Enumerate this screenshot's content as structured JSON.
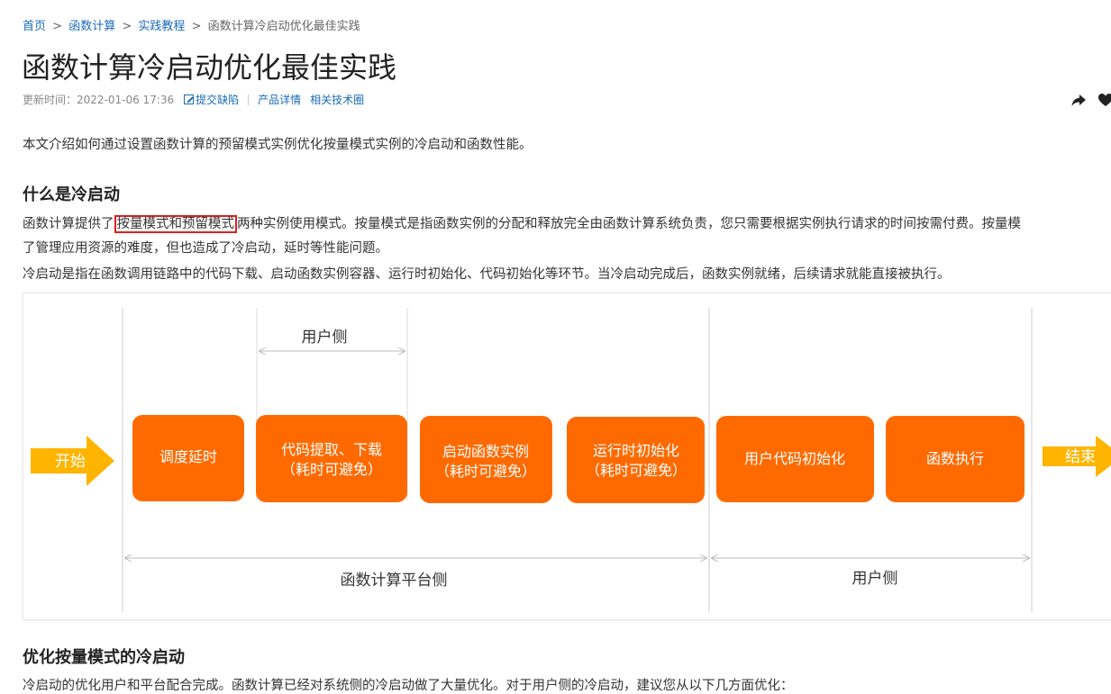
{
  "breadcrumb": {
    "home": "首页",
    "sep1": ">",
    "fc": "函数计算",
    "sep2": ">",
    "tutorial": "实践教程",
    "sep3": ">",
    "current": "函数计算冷启动优化最佳实践"
  },
  "title": "函数计算冷启动优化最佳实践",
  "meta": {
    "updated": "更新时间：2022-01-06 17:36",
    "report": "提交缺陷",
    "product": "产品详情",
    "circle": "相关技术圈"
  },
  "intro": "本文介绍如何通过设置函数计算的预留模式实例优化按量模式实例的冷启动和函数性能。",
  "section1": {
    "heading": "什么是冷启动",
    "p1_before": "函数计算提供了",
    "p1_highlight": "按量模式和预留模式",
    "p1_after": "两种实例使用模式。按量模式是指函数实例的分配和释放完全由函数计算系统负责，您只需要根据实例执行请求的时间按需付费。按量模",
    "p2": "了管理应用资源的难度，但也造成了冷启动，延时等性能问题。",
    "p3": "冷启动是指在函数调用链路中的代码下载、启动函数实例容器、运行时初始化、代码初始化等环节。当冷启动完成后，函数实例就绪，后续请求就能直接被执行。"
  },
  "diagram": {
    "start": "开始",
    "end": "结束",
    "user_side_top": "用户侧",
    "platform_side": "函数计算平台侧",
    "user_side_bottom": "用户侧",
    "step1": "调度延时",
    "step2_l1": "代码提取、下载",
    "step2_l2": "（耗时可避免）",
    "step3_l1": "启动函数实例",
    "step3_l2": "（耗时可避免）",
    "step4_l1": "运行时初始化",
    "step4_l2": "（耗时可避免）",
    "step5": "用户代码初始化",
    "step6": "函数执行",
    "colors": {
      "box": "#ff6a00",
      "arrow": "#ffb400"
    }
  },
  "section2": {
    "heading": "优化按量模式的冷启动",
    "p1": "冷启动的优化用户和平台配合完成。函数计算已经对系统侧的冷启动做了大量优化。对于用户侧的冷启动，建议您从以下几方面优化："
  },
  "icons": [
    "edit-icon",
    "share-icon",
    "heart-icon"
  ]
}
